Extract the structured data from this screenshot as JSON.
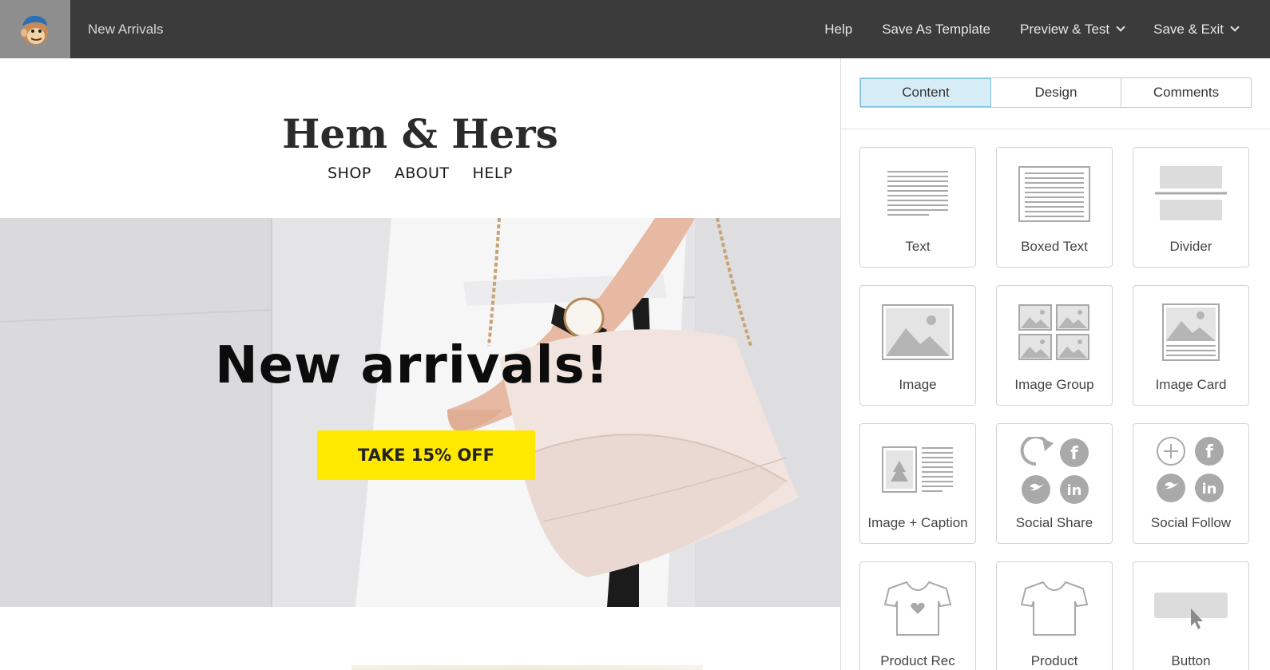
{
  "app": {
    "doc_title": "New Arrivals",
    "nav": [
      {
        "label": "Help"
      },
      {
        "label": "Save As Template"
      },
      {
        "label": "Preview & Test"
      },
      {
        "label": "Save & Exit"
      }
    ]
  },
  "email": {
    "brand": "Hem & Hers",
    "nav": [
      "SHOP",
      "ABOUT",
      "HELP"
    ],
    "hero_title": "New arrivals!",
    "cta_label": "TAKE 15% OFF",
    "cta_color": "#ffe900"
  },
  "panel": {
    "tabs": [
      {
        "label": "Content",
        "active": true
      },
      {
        "label": "Design",
        "active": false
      },
      {
        "label": "Comments",
        "active": false
      }
    ],
    "blocks": [
      {
        "label": "Text",
        "icon": "text-block-icon"
      },
      {
        "label": "Boxed Text",
        "icon": "boxed-text-block-icon"
      },
      {
        "label": "Divider",
        "icon": "divider-block-icon"
      },
      {
        "label": "Image",
        "icon": "image-block-icon"
      },
      {
        "label": "Image Group",
        "icon": "image-group-block-icon"
      },
      {
        "label": "Image Card",
        "icon": "image-card-block-icon"
      },
      {
        "label": "Image + Caption",
        "icon": "image-caption-block-icon"
      },
      {
        "label": "Social Share",
        "icon": "social-share-block-icon"
      },
      {
        "label": "Social Follow",
        "icon": "social-follow-block-icon"
      },
      {
        "label": "Product Rec",
        "icon": "product-rec-block-icon"
      },
      {
        "label": "Product",
        "icon": "product-block-icon"
      },
      {
        "label": "Button",
        "icon": "button-block-icon"
      }
    ]
  },
  "colors": {
    "topbar": "#3b3b3b",
    "active_tab": "#d6edf7",
    "icon_gray": "#a9a9a9"
  }
}
